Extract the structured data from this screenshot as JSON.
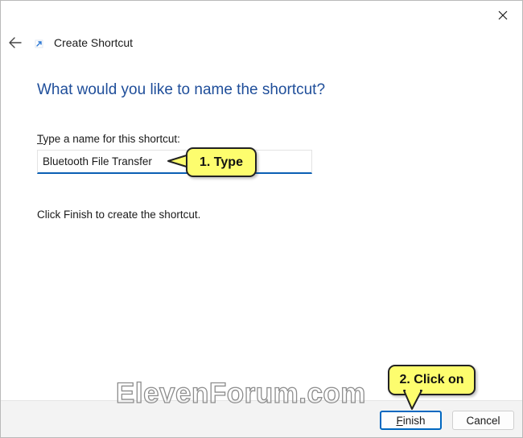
{
  "window": {
    "title": "Create Shortcut"
  },
  "icons": {
    "close": "close-icon",
    "back": "back-arrow-icon",
    "shortcut": "shortcut-arrow-icon"
  },
  "main": {
    "heading": "What would you like to name the shortcut?",
    "field_label_accel": "T",
    "field_label_rest": "ype a name for this shortcut:",
    "input_value": "Bluetooth File Transfer",
    "instruction": "Click Finish to create the shortcut."
  },
  "footer": {
    "finish_accel": "F",
    "finish_rest": "inish",
    "cancel_label": "Cancel"
  },
  "annotations": {
    "step1": "1. Type",
    "step2": "2. Click on",
    "watermark": "ElevenForum.com"
  },
  "colors": {
    "heading": "#1f4e9a",
    "accent": "#0067c0",
    "callout_fill": "#fdfd6e"
  }
}
